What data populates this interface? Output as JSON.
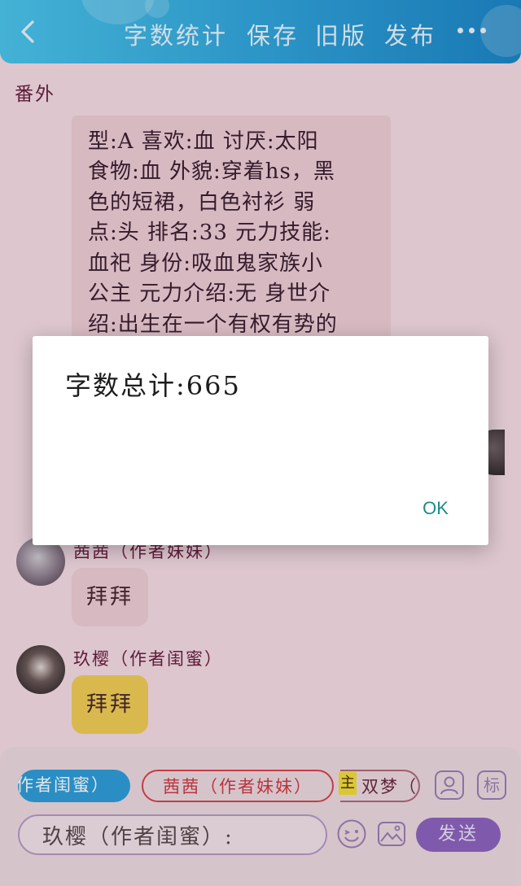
{
  "header": {
    "back_icon": "back-chevron-icon",
    "word_count": "字数统计",
    "save": "保存",
    "old_version": "旧版",
    "publish": "发布",
    "more_icon": "more-dots-icon"
  },
  "chat": {
    "chapter_label": "番外",
    "long_message_lines": [
      "型:A 喜欢:血 讨厌:太阳",
      "食物:血 外貌:穿着hs，黑",
      "色的短裙，白色衬衫 弱",
      "点:头 排名:33 元力技能:",
      "血祀 身份:吸血鬼家族小",
      "公主 元力介绍:无 身世介",
      "绍:出生在一个有权有势的"
    ],
    "messages": [
      {
        "sender": "茜茜（作者妹妹）",
        "text": "拜拜",
        "bubble_color": "#f0cfd8"
      },
      {
        "sender": "玖樱（作者闺蜜）",
        "text": "拜拜",
        "bubble_color": "#f2cf56"
      }
    ]
  },
  "input_bar": {
    "roles": [
      {
        "label": "作者闺蜜）",
        "active": true
      },
      {
        "label": "茜茜（作者妹妹）",
        "active": false
      },
      {
        "label": "双梦（",
        "active": false,
        "tag": "主"
      }
    ],
    "role_icon": "user-profile-icon",
    "tag_button": "标",
    "input_value": "玖樱（作者闺蜜）:",
    "emoji_icon": "emoji-icon",
    "image_icon": "image-icon",
    "send_label": "发送"
  },
  "dialog": {
    "message": "字数总计:665",
    "ok_label": "OK"
  },
  "colors": {
    "header_blue": "#2fa3dc",
    "background_pink": "#f7dde6",
    "send_purple": "#8e65c0",
    "ok_teal": "#1a8c86"
  }
}
